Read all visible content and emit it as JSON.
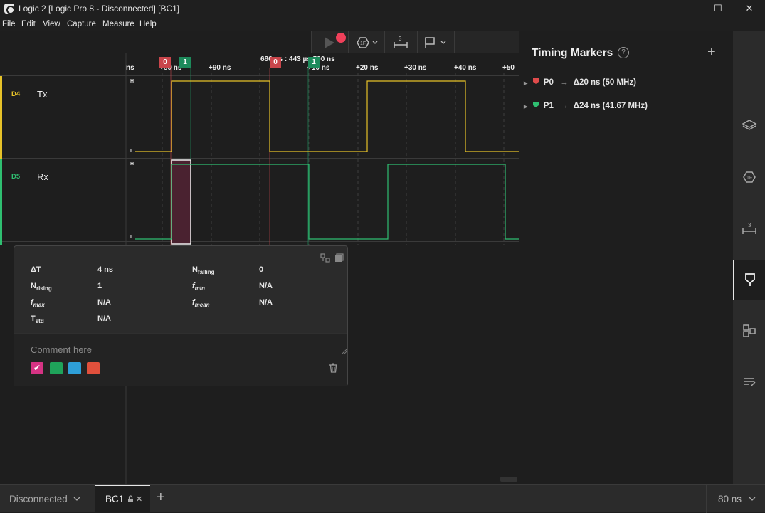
{
  "window": {
    "title": "Logic 2 [Logic Pro 8 - Disconnected] [BC1]",
    "minimize": "—",
    "maximize": "☐",
    "close": "✕"
  },
  "menu": [
    "File",
    "Edit",
    "View",
    "Capture",
    "Measure",
    "Help"
  ],
  "ruler": {
    "ticks": [
      "ns",
      "+80 ns",
      "+90 ns",
      "+10 ns",
      "+20 ns",
      "+30 ns",
      "+40 ns",
      "+50"
    ],
    "center_label": "686 ns : 443 µs 500 ns",
    "markers": {
      "red_a": "0",
      "green_a": "1",
      "red_b": "0",
      "green_b": "1"
    }
  },
  "channels": [
    {
      "num": "D4",
      "name": "Tx",
      "high": "H",
      "low": "L",
      "color": "#e6c229"
    },
    {
      "num": "D5",
      "name": "Rx",
      "high": "H",
      "low": "L",
      "color": "#2fbf71"
    }
  ],
  "measurement": {
    "delta_t": {
      "label": "ΔT",
      "value": "4 ns"
    },
    "n_falling": {
      "label": "N",
      "sub": "falling",
      "value": "0"
    },
    "n_rising": {
      "label": "N",
      "sub": "rising",
      "value": "1"
    },
    "f_min": {
      "label": "f",
      "sub": "min",
      "value": "N/A"
    },
    "f_max": {
      "label": "f",
      "sub": "max",
      "value": "N/A"
    },
    "f_mean": {
      "label": "f",
      "sub": "mean",
      "value": "N/A"
    },
    "t_std": {
      "label": "T",
      "sub": "std",
      "value": "N/A"
    },
    "comment_placeholder": "Comment here",
    "swatches": [
      "#d63384",
      "#1fa35a",
      "#2e9fd8",
      "#e0503c"
    ]
  },
  "panel": {
    "title": "Timing Markers",
    "add": "+",
    "markers": [
      {
        "name": "P0",
        "delta": "Δ20 ns (50 MHz)",
        "color": "#e04b4b"
      },
      {
        "name": "P1",
        "delta": "Δ24 ns (41.67 MHz)",
        "color": "#2fbf71"
      }
    ]
  },
  "status": {
    "connection": "Disconnected",
    "tab": "BC1",
    "add": "+",
    "zoom": "80 ns"
  }
}
